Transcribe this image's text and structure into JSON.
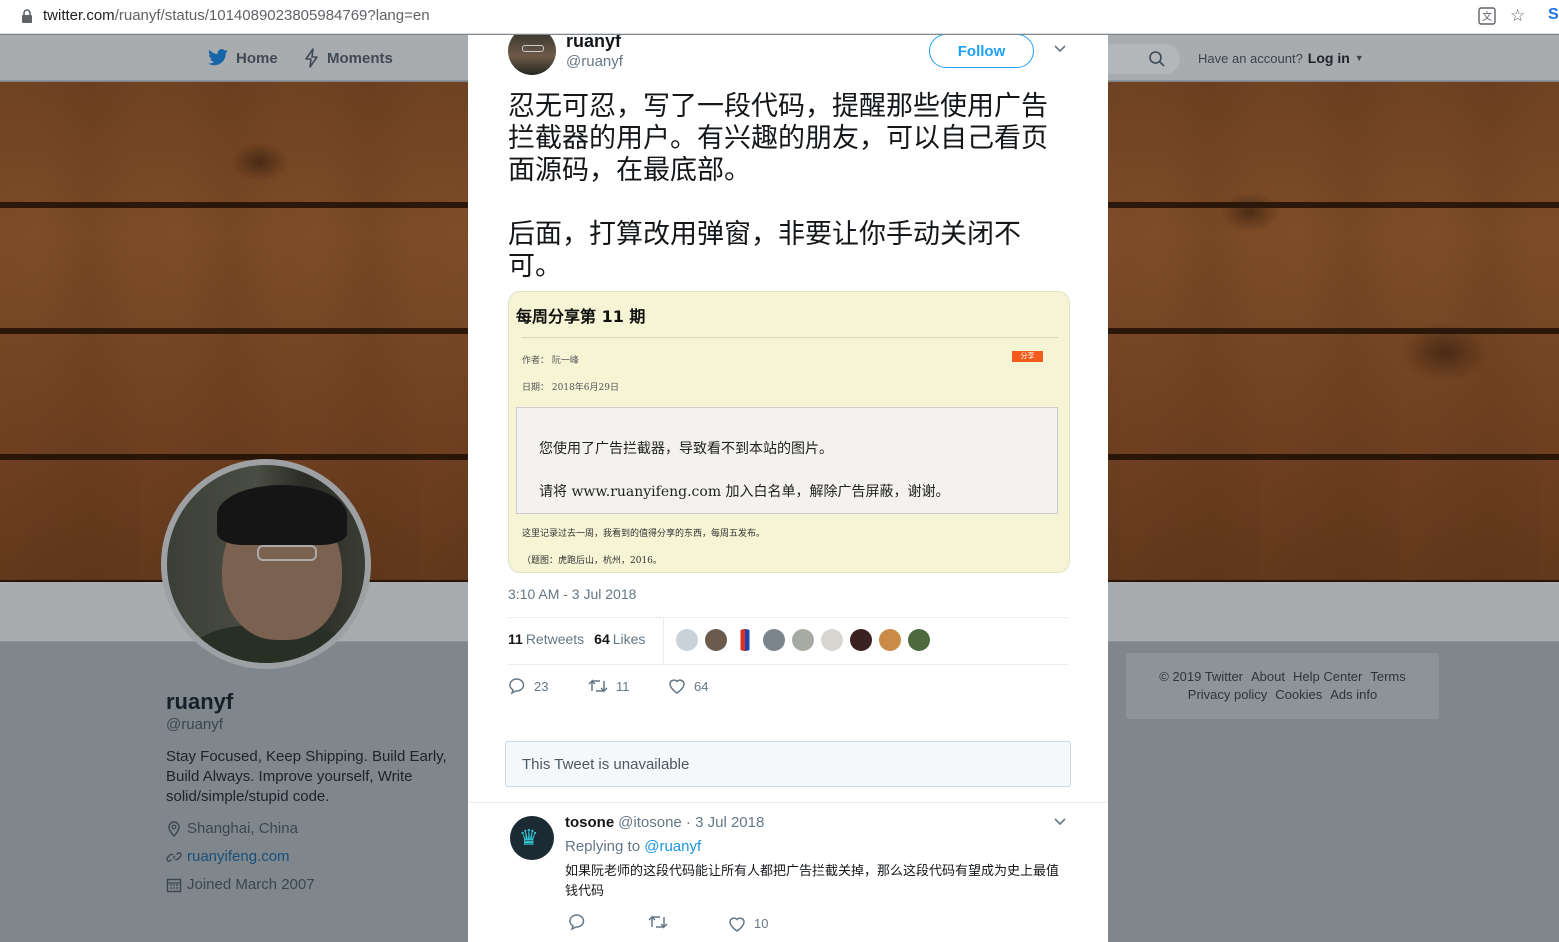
{
  "browser": {
    "url_host": "twitter.com",
    "url_path": "/ruanyf/status/1014089023805984769?lang=en"
  },
  "nav": {
    "home": "Home",
    "moments": "Moments",
    "have_account": "Have an account?",
    "login": "Log in"
  },
  "profile": {
    "name": "ruanyf",
    "handle": "@ruanyf",
    "bio": "Stay Focused, Keep Shipping. Build Early, Build Always. Improve yourself, Write solid/simple/stupid code.",
    "location": "Shanghai, China",
    "website": "ruanyifeng.com",
    "joined": "Joined March 2007"
  },
  "footer": {
    "row1": [
      "© 2019 Twitter",
      "About",
      "Help Center",
      "Terms"
    ],
    "row2": [
      "Privacy policy",
      "Cookies",
      "Ads info"
    ]
  },
  "tweet": {
    "author_name": "ruanyf",
    "author_handle": "@ruanyf",
    "follow_label": "Follow",
    "paragraph1": "忍无可忍，写了一段代码，提醒那些使用广告\n拦截器的用户。有兴趣的朋友，可以自己看页\n面源码，在最底部。",
    "paragraph2": "后面，打算改用弹窗，非要让你手动关闭不\n可。",
    "timestamp": "3:10 AM - 3 Jul 2018",
    "retweets_count": "11",
    "retweets_label": "Retweets",
    "likes_count": "64",
    "likes_label": "Likes",
    "reply_count": "23",
    "retweet_action_count": "11",
    "like_action_count": "64"
  },
  "card": {
    "title": "每周分享第 11 期",
    "author": "作者：  阮一峰",
    "date": "日期：  2018年6月29日",
    "badge": "分享",
    "notice_line1": "您使用了广告拦截器，导致看不到本站的图片。",
    "notice_line2": "请将 www.ruanyifeng.com 加入白名单，解除广告屏蔽，谢谢。",
    "footer_line1": "这里记录过去一周，我看到的值得分享的东西，每周五发布。",
    "footer_line2": "（题图：虎跑后山，杭州，2016。"
  },
  "unavailable_text": "This Tweet is unavailable",
  "reply": {
    "name": "tosone",
    "meta": "@itosone · 3 Jul 2018",
    "replying_prefix": "Replying to",
    "replying_to": "@ruanyf",
    "text": "如果阮老师的这段代码能让所有人都把广告拦截关掉，那么这段代码有望成为史上最值钱代码",
    "like_count": "10"
  },
  "colors": {
    "twitter_blue": "#1da1f2",
    "card_bg": "#f5f5d5",
    "badge": "#f25d1e"
  }
}
